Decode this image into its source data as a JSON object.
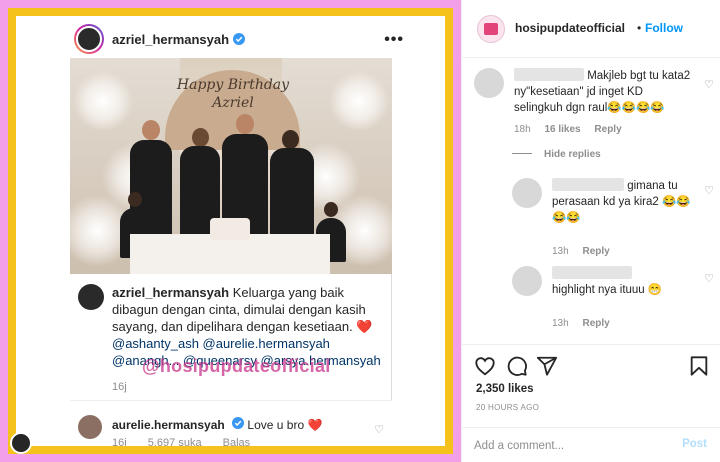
{
  "post_image": {
    "card": {
      "username": "azriel_hermansyah",
      "more_label": "•••",
      "photo_banner_line1": "Happy Birthday",
      "photo_banner_line2": "Azriel"
    },
    "caption": {
      "username": "azriel_hermansyah",
      "text": "Keluarga yang baik dibagun dengan cinta, dimulai dengan kasih sayang, dan dipelihara dengan kesetiaan.",
      "heart": "❤️",
      "mentions": "@ashanty_ash @aurelie.hermansyah @anangh... @queenarsy @arsya.hermansyah",
      "watermark": "@hosipupdateofficial",
      "time": "16j"
    },
    "reply": {
      "username": "aurelie.hermansyah",
      "text": "Love u bro",
      "heart": "❤️",
      "time": "16j",
      "likes": "5.697 suka",
      "reply_label": "Balas"
    }
  },
  "panel": {
    "header": {
      "username": "hosipupdateofficial",
      "separator": "•",
      "follow_label": "Follow"
    },
    "comments": [
      {
        "text": "Makjleb bgt tu kata2 ny\"kesetiaan\" jd inget KD selingkuh dgn raul😂😂😂😂",
        "time": "18h",
        "likes": "16 likes",
        "reply_label": "Reply"
      },
      {
        "text": "gimana tu perasaan kd ya kira2 😂😂😂😂",
        "time": "13h",
        "reply_label": "Reply"
      },
      {
        "text": "highlight nya ituuu 😁",
        "time": "13h",
        "reply_label": "Reply"
      }
    ],
    "hide_replies_label": "Hide replies",
    "likes": "2,350 likes",
    "time_ago": "20 HOURS AGO",
    "add_comment_placeholder": "Add a comment...",
    "post_label": "Post"
  },
  "colors": {
    "accent": "#0095f6",
    "pink_frame": "#f4a0e8",
    "gold_frame": "#f5c21b",
    "watermark": "#c9328a"
  }
}
